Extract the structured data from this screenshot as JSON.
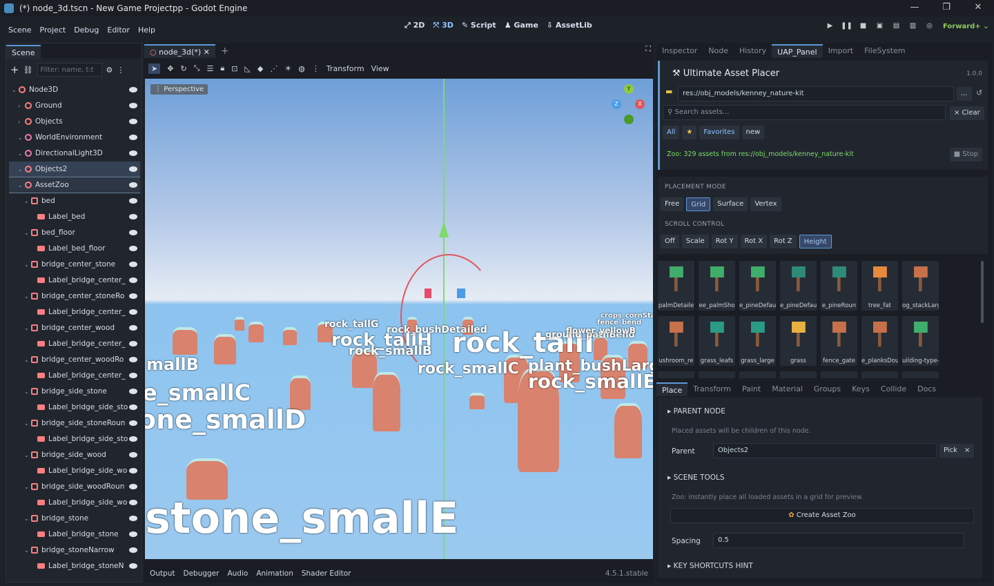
{
  "window": {
    "title": "(*) node_3d.tscn - New Game Projectpp - Godot Engine",
    "minimize": "—",
    "maximize": "❐",
    "close": "✕"
  },
  "menu": [
    "Scene",
    "Project",
    "Debug",
    "Editor",
    "Help"
  ],
  "workspaces": [
    "2D",
    "3D",
    "Script",
    "Game",
    "AssetLib"
  ],
  "workspace_active": "3D",
  "renderer": "Forward+",
  "scene_dock": {
    "tab": "Scene",
    "filter_placeholder": "Filter: name, t:t",
    "nodes": [
      {
        "name": "Node3D",
        "depth": 0,
        "icon": "node3d"
      },
      {
        "name": "Ground",
        "depth": 1,
        "icon": "node3d",
        "collapsed": true
      },
      {
        "name": "Objects",
        "depth": 1,
        "icon": "node3d",
        "collapsed": true
      },
      {
        "name": "WorldEnvironment",
        "depth": 1,
        "icon": "env"
      },
      {
        "name": "DirectionalLight3D",
        "depth": 1,
        "icon": "light"
      },
      {
        "name": "Objects2",
        "depth": 1,
        "icon": "node3d",
        "selected": true
      },
      {
        "name": "AssetZoo",
        "depth": 1,
        "icon": "node3d",
        "highlight": true
      },
      {
        "name": "bed",
        "depth": 2,
        "icon": "mesh"
      },
      {
        "name": "Label_bed",
        "depth": 3,
        "icon": "label"
      },
      {
        "name": "bed_floor",
        "depth": 2,
        "icon": "mesh"
      },
      {
        "name": "Label_bed_floor",
        "depth": 3,
        "icon": "label"
      },
      {
        "name": "bridge_center_stone",
        "depth": 2,
        "icon": "mesh"
      },
      {
        "name": "Label_bridge_center_",
        "depth": 3,
        "icon": "label"
      },
      {
        "name": "bridge_center_stoneRo",
        "depth": 2,
        "icon": "mesh"
      },
      {
        "name": "Label_bridge_center_",
        "depth": 3,
        "icon": "label"
      },
      {
        "name": "bridge_center_wood",
        "depth": 2,
        "icon": "mesh"
      },
      {
        "name": "Label_bridge_center_",
        "depth": 3,
        "icon": "label"
      },
      {
        "name": "bridge_center_woodRo",
        "depth": 2,
        "icon": "mesh"
      },
      {
        "name": "Label_bridge_center_",
        "depth": 3,
        "icon": "label"
      },
      {
        "name": "bridge_side_stone",
        "depth": 2,
        "icon": "mesh"
      },
      {
        "name": "Label_bridge_side_sto",
        "depth": 3,
        "icon": "label"
      },
      {
        "name": "bridge_side_stoneRoun",
        "depth": 2,
        "icon": "mesh"
      },
      {
        "name": "Label_bridge_side_sto",
        "depth": 3,
        "icon": "label"
      },
      {
        "name": "bridge_side_wood",
        "depth": 2,
        "icon": "mesh"
      },
      {
        "name": "Label_bridge_side_wo",
        "depth": 3,
        "icon": "label"
      },
      {
        "name": "bridge_side_woodRoun",
        "depth": 2,
        "icon": "mesh"
      },
      {
        "name": "Label_bridge_side_wo",
        "depth": 3,
        "icon": "label"
      },
      {
        "name": "bridge_stone",
        "depth": 2,
        "icon": "mesh"
      },
      {
        "name": "Label_bridge_stone",
        "depth": 3,
        "icon": "label"
      },
      {
        "name": "bridge_stoneNarrow",
        "depth": 2,
        "icon": "mesh"
      },
      {
        "name": "Label_bridge_stoneN",
        "depth": 3,
        "icon": "label"
      }
    ]
  },
  "viewport": {
    "tab": "node_3d(*)",
    "menu_transform": "Transform",
    "menu_view": "View",
    "perspective": "Perspective",
    "labels": [
      {
        "t": "stone_smallE",
        "size": 62
      },
      {
        "t": "one_smallD",
        "size": 38
      },
      {
        "t": "e_smallC",
        "size": 32
      },
      {
        "t": "mallB",
        "size": 24
      },
      {
        "t": "rock_tallI",
        "size": 40
      },
      {
        "t": "rock_smallE",
        "size": 28
      },
      {
        "t": "plant_bushLarg",
        "size": 22
      },
      {
        "t": "rock_tallH",
        "size": 26
      },
      {
        "t": "rock_smallC",
        "size": 22
      },
      {
        "t": "rock_smallB",
        "size": 18
      },
      {
        "t": "rock_tallG",
        "size": 14
      },
      {
        "t": "rock_bushDetailed",
        "size": 14
      },
      {
        "t": "ground_pathBend",
        "size": 13
      },
      {
        "t": "flower_yellowB",
        "size": 12
      },
      {
        "t": "crops_cornSta",
        "size": 10
      },
      {
        "t": "fence_bend",
        "size": 10
      }
    ]
  },
  "bottom_bar": {
    "tabs": [
      "Output",
      "Debugger",
      "Audio",
      "Animation",
      "Shader Editor"
    ],
    "version": "4.5.1.stable"
  },
  "right_dock": {
    "tabs": [
      "Inspector",
      "Node",
      "History",
      "UAP_Panel",
      "Import",
      "FileSystem"
    ],
    "active_tab": "UAP_Panel",
    "plugin_title": "Ultimate Asset Placer",
    "plugin_version": "1.0.0",
    "path": "res://obj_models/kenney_nature-kit",
    "path_btn": "...",
    "search_placeholder": "Search assets...",
    "clear": "× Clear",
    "filters": [
      "All",
      "Favorites",
      "new"
    ],
    "zoo_status": "Zoo: 329 assets from res://obj_models/kenney_nature-kit",
    "stop": "■ Stop",
    "placement_label": "PLACEMENT MODE",
    "placement": [
      "Free",
      "Grid",
      "Surface",
      "Vertex"
    ],
    "placement_active": "Grid",
    "scroll_label": "SCROLL CONTROL",
    "scroll": [
      "Off",
      "Scale",
      "Rot Y",
      "Rot X",
      "Rot Z",
      "Height"
    ],
    "scroll_active": "Height",
    "assets": [
      {
        "name": "palmDetaile",
        "icon": "palm-tree-icon",
        "color": "#3fae6b"
      },
      {
        "name": "ee_palmSho",
        "icon": "palm-tree-icon",
        "color": "#3fae6b"
      },
      {
        "name": "e_pineDefau",
        "icon": "palm-tree-icon",
        "color": "#3fae6b"
      },
      {
        "name": "e_pineDefau",
        "icon": "pine-tree-icon",
        "color": "#2f8a7a"
      },
      {
        "name": "e_pineRoun",
        "icon": "pine-tree-icon",
        "color": "#2f8a7a"
      },
      {
        "name": "tree_fat",
        "icon": "fat-tree-icon",
        "color": "#e88a3c"
      },
      {
        "name": "og_stackLarg",
        "icon": "log-stack-icon",
        "color": "#c7704a"
      },
      {
        "name": "ushroom_re",
        "icon": "log-stack-icon",
        "color": "#c7704a"
      },
      {
        "name": "grass_leafs",
        "icon": "grass-icon",
        "color": "#2a9c86"
      },
      {
        "name": "grass_large",
        "icon": "grass-icon",
        "color": "#2a9c86"
      },
      {
        "name": "grass",
        "icon": "grass-icon",
        "color": "#e8b040"
      },
      {
        "name": "fence_gate",
        "icon": "fence-icon",
        "color": "#c7704a"
      },
      {
        "name": "e_planksDou",
        "icon": "fence-icon",
        "color": "#c7704a"
      },
      {
        "name": "uilding-type-",
        "icon": "house-icon",
        "color": "#3fae6b"
      }
    ],
    "lower_tabs": [
      "Place",
      "Transform",
      "Paint",
      "Material",
      "Groups",
      "Keys",
      "Collide",
      "Docs"
    ],
    "lower_active": "Place",
    "parent_section": "PARENT NODE",
    "parent_hint": "Placed assets will be children of this node.",
    "parent_label": "Parent",
    "parent_value": "Objects2",
    "pick": "Pick",
    "clear_x": "×",
    "scene_tools": "SCENE TOOLS",
    "zoo_hint": "Zoo: instantly place all loaded assets in a grid for preview.",
    "create_zoo": "Create Asset Zoo",
    "spacing_label": "Spacing",
    "spacing_value": "0.5",
    "shortcuts": "KEY SHORTCUTS HINT"
  }
}
